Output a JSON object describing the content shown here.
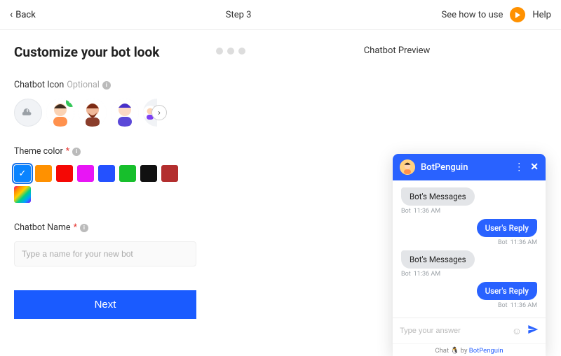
{
  "header": {
    "back_label": "Back",
    "step_label": "Step 3",
    "see_how_label": "See how to use",
    "help_label": "Help"
  },
  "left": {
    "title": "Customize your bot look",
    "icon_section": {
      "label": "Chatbot Icon",
      "optional": "Optional"
    },
    "theme_section": {
      "label": "Theme color",
      "swatches": [
        {
          "color": "#0a84ff",
          "selected": true
        },
        {
          "color": "#ff9100"
        },
        {
          "color": "#f50805"
        },
        {
          "color": "#e815f5"
        },
        {
          "color": "#2451ff"
        },
        {
          "color": "#17bf2c"
        },
        {
          "color": "#111111"
        },
        {
          "color": "#b32e2e"
        }
      ]
    },
    "name_section": {
      "label": "Chatbot Name",
      "placeholder": "Type a name for your new bot",
      "value": ""
    },
    "next_label": "Next"
  },
  "right": {
    "preview_label": "Chatbot Preview"
  },
  "chat": {
    "title": "BotPenguin",
    "messages": [
      {
        "side": "bot",
        "text": "Bot's Messages",
        "sender": "Bot",
        "time": "11:36 AM"
      },
      {
        "side": "user",
        "text": "User's Reply",
        "sender": "Bot",
        "time": "11:36 AM"
      },
      {
        "side": "bot",
        "text": "Bot's Messages",
        "sender": "Bot",
        "time": "11:36 AM"
      },
      {
        "side": "user",
        "text": "User's Reply",
        "sender": "Bot",
        "time": "11:36 AM"
      }
    ],
    "input_placeholder": "Type your answer",
    "footer_prefix": "Chat",
    "footer_penguin": "🐧",
    "footer_by": "by",
    "footer_brand": "BotPenguin"
  }
}
